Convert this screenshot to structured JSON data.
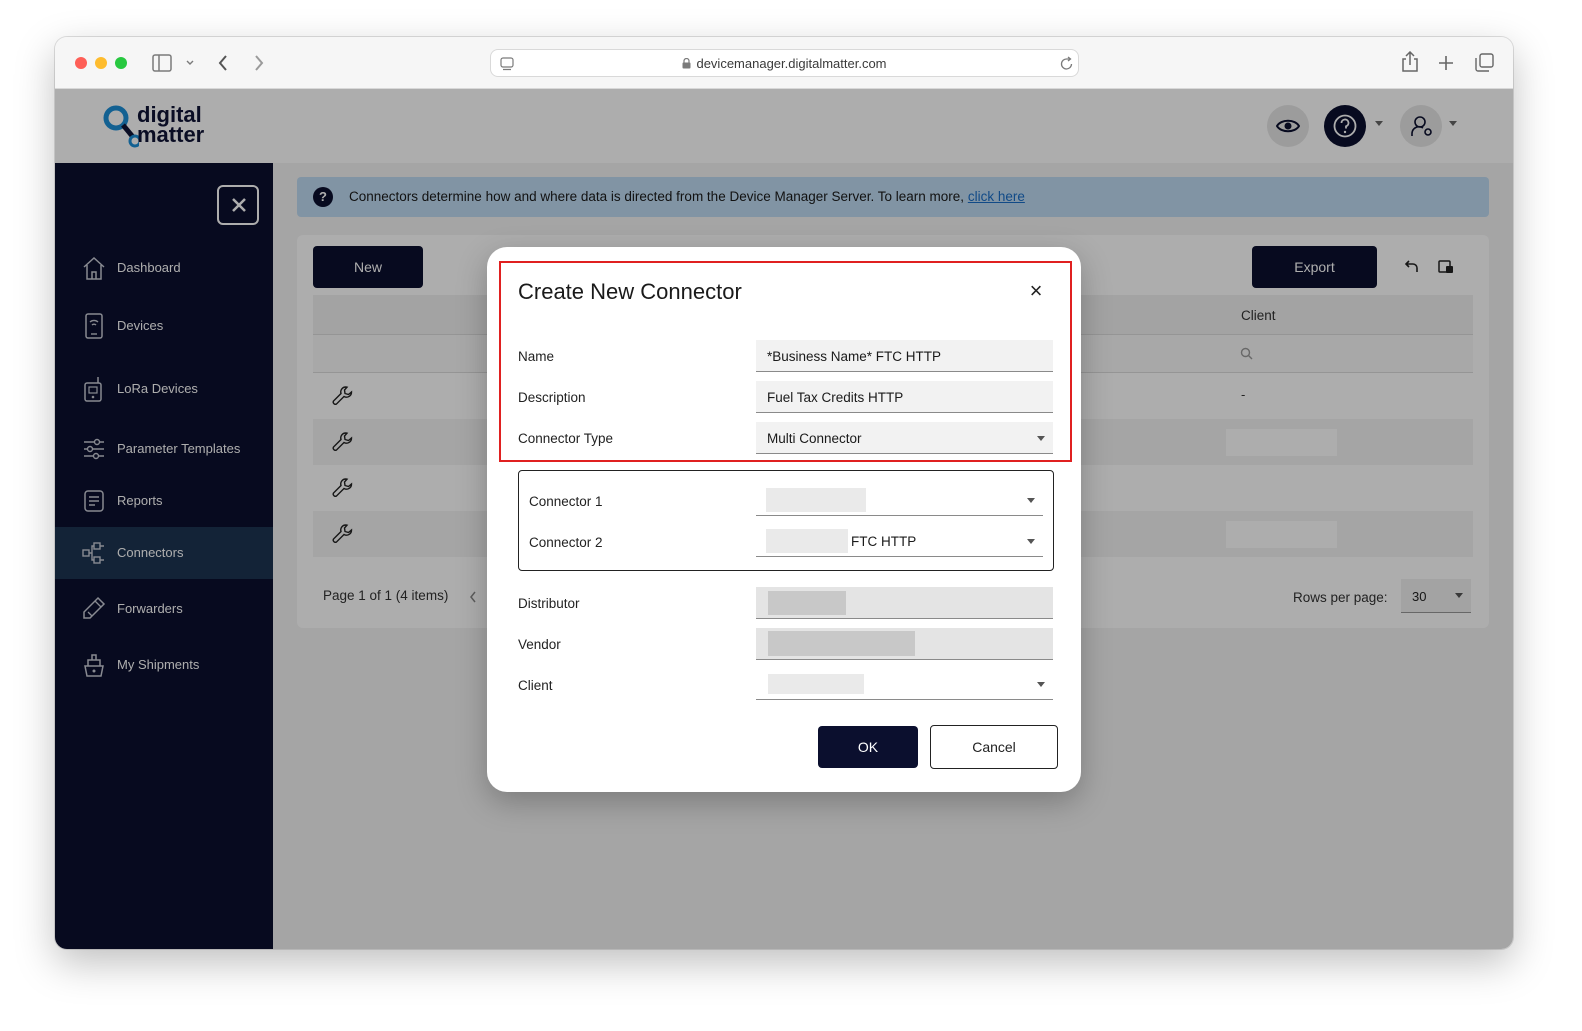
{
  "browser": {
    "url": "devicemanager.digitalmatter.com"
  },
  "app": {
    "logo_line1": "digital",
    "logo_line2": "matter"
  },
  "sidebar": {
    "items": [
      {
        "label": "Dashboard",
        "icon": "home-icon"
      },
      {
        "label": "Devices",
        "icon": "device-icon"
      },
      {
        "label": "LoRa Devices",
        "icon": "lora-device-icon"
      },
      {
        "label": "Parameter Templates",
        "icon": "sliders-icon"
      },
      {
        "label": "Reports",
        "icon": "report-icon"
      },
      {
        "label": "Connectors",
        "icon": "connectors-icon",
        "active": true
      },
      {
        "label": "Forwarders",
        "icon": "forwarder-icon"
      },
      {
        "label": "My Shipments",
        "icon": "shipment-icon"
      }
    ]
  },
  "banner": {
    "text": "Connectors determine how and where data is directed from the Device Manager Server. To learn more,",
    "link": "click here"
  },
  "toolbar": {
    "new_label": "New",
    "export_label": "Export"
  },
  "grid": {
    "client_header": "Client",
    "first_client_value": "-"
  },
  "pager": {
    "summary": "Page 1 of 1 (4 items)",
    "rows_label": "Rows per page:",
    "rows_value": "30"
  },
  "dialog": {
    "title": "Create New Connector",
    "close_symbol": "×",
    "fields": {
      "name_label": "Name",
      "name_value": "*Business Name* FTC HTTP",
      "description_label": "Description",
      "description_value": "Fuel Tax Credits HTTP",
      "type_label": "Connector Type",
      "type_value": "Multi Connector",
      "connector1_label": "Connector 1",
      "connector2_label": "Connector 2",
      "connector2_value": "FTC HTTP",
      "distributor_label": "Distributor",
      "vendor_label": "Vendor",
      "client_label": "Client"
    },
    "ok_label": "OK",
    "cancel_label": "Cancel"
  },
  "colors": {
    "navy": "#0b0f2e",
    "active_nav": "#1d3452",
    "banner": "#bfdbf2",
    "highlight_border": "#e02020",
    "link": "#1a6ec8"
  }
}
